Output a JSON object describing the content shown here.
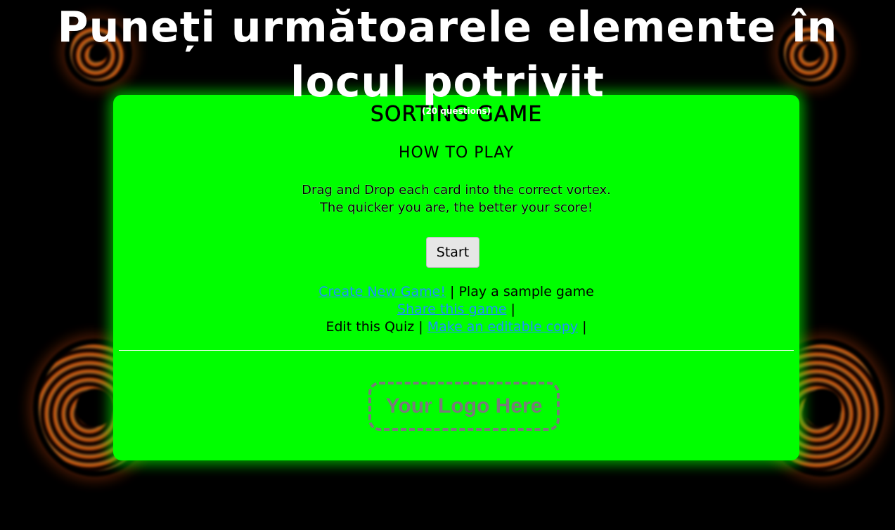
{
  "header": {
    "title": "Puneți următoarele elemente în locul potrivit",
    "question_count": "(20 questions)"
  },
  "panel": {
    "game_type": "SORTING GAME",
    "howto_heading": "HOW TO PLAY",
    "instruction_line1": "Drag and Drop each card into the correct vortex.",
    "instruction_line2": "The quicker you are, the better your score!",
    "start_label": "Start"
  },
  "links": {
    "create_new": "Create New Game!",
    "sep1": " | ",
    "play_sample": "Play a sample game",
    "share": "Share this game",
    "sep2": " | ",
    "edit_quiz": "Edit this Quiz",
    "sep3": " | ",
    "editable_copy": "Make an editable copy",
    "sep4": " | "
  },
  "logo": {
    "placeholder": "Your Logo Here"
  },
  "colors": {
    "background": "#000000",
    "panel": "#00ff00",
    "link": "#1e90ff",
    "logo_placeholder": "#7a7a7a"
  },
  "icons": [
    "vortex-icon"
  ]
}
